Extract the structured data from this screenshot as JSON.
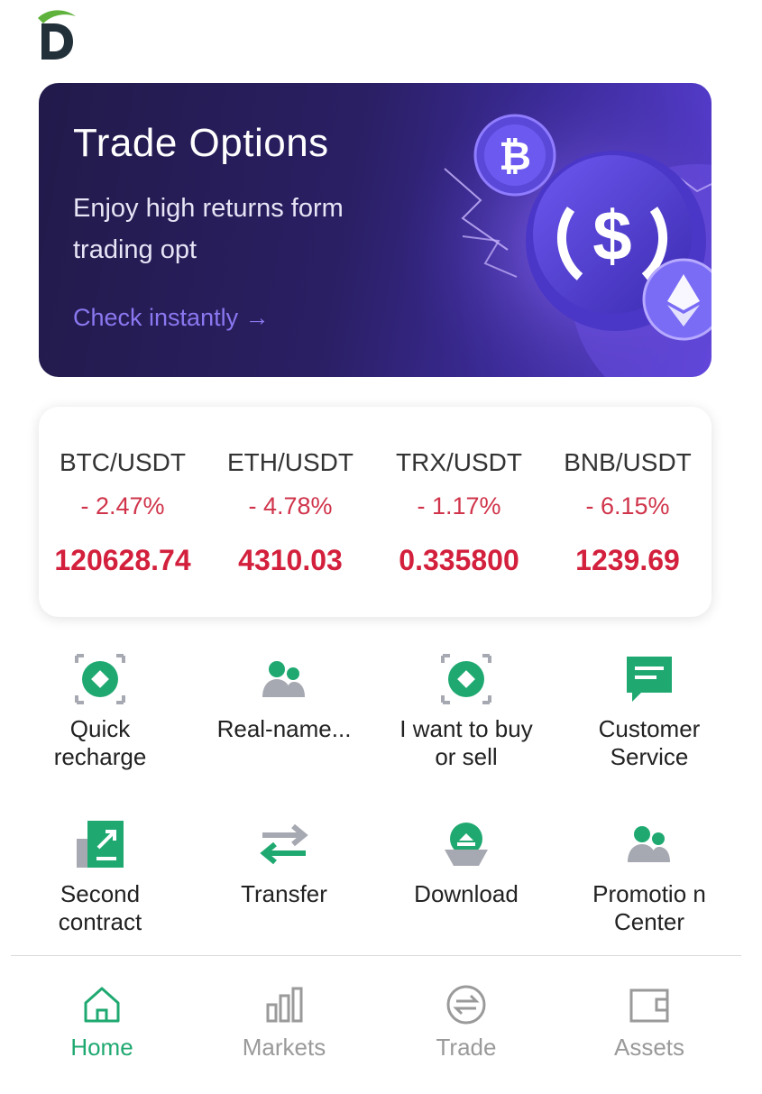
{
  "banner": {
    "title": "Trade Options",
    "subtitle": "Enjoy high returns form trading opt",
    "cta": "Check instantly →"
  },
  "ticker": [
    {
      "pair": "BTC/USDT",
      "change": "- 2.47%",
      "price": "120628.74"
    },
    {
      "pair": "ETH/USDT",
      "change": "- 4.78%",
      "price": "4310.03"
    },
    {
      "pair": "TRX/USDT",
      "change": "- 1.17%",
      "price": "0.335800"
    },
    {
      "pair": "BNB/USDT",
      "change": "- 6.15%",
      "price": "1239.69"
    }
  ],
  "shortcuts": [
    {
      "label": "Quick recharge",
      "icon": "quick-recharge-icon"
    },
    {
      "label": "Real-name...",
      "icon": "users-icon"
    },
    {
      "label": "I want to buy or sell",
      "icon": "otc-trade-icon"
    },
    {
      "label": "Customer Service",
      "icon": "chat-message-icon"
    },
    {
      "label": "Second contract",
      "icon": "contract-document-icon"
    },
    {
      "label": "Transfer",
      "icon": "transfer-arrows-icon"
    },
    {
      "label": "Download",
      "icon": "download-icon"
    },
    {
      "label": "Promotio n Center",
      "icon": "users-icon"
    }
  ],
  "nav": [
    {
      "label": "Home",
      "icon": "home-icon",
      "active": true
    },
    {
      "label": "Markets",
      "icon": "bar-chart-icon",
      "active": false
    },
    {
      "label": "Trade",
      "icon": "exchange-icon",
      "active": false
    },
    {
      "label": "Assets",
      "icon": "wallet-icon",
      "active": false
    }
  ],
  "colors": {
    "accent_green": "#1fa971",
    "price_red": "#d3203d",
    "banner_cta": "#8a78f0",
    "icon_gray": "#a7a9b2"
  }
}
